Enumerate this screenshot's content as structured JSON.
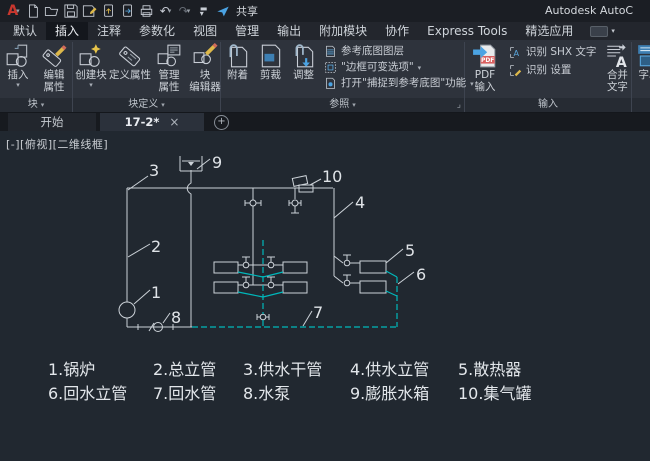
{
  "window": {
    "app_title": "Autodesk AutoC",
    "share_label": "共享"
  },
  "ribbon_tabs": [
    "默认",
    "插入",
    "注释",
    "参数化",
    "视图",
    "管理",
    "输出",
    "附加模块",
    "协作",
    "Express Tools",
    "精选应用"
  ],
  "panels": {
    "block": {
      "name": "块",
      "insert": "插入",
      "edit1": "编辑",
      "edit2": "属性"
    },
    "blockdef": {
      "name": "块定义",
      "create": "创建块",
      "defattr": "定义属性",
      "manage1": "管理",
      "manage2": "属性",
      "editor1": "块",
      "editor2": "编辑器"
    },
    "reference": {
      "name": "参照",
      "attach": "附着",
      "clip": "剪裁",
      "adjust": "调整",
      "row1": "参考底图图层",
      "row2": "\"边框可变选项\"",
      "row3": "打开\"捕捉到参考底图\"功能"
    },
    "import": {
      "name": "输入",
      "pdf1": "PDF",
      "pdf2": "输入",
      "shx": "识别 SHX 文字",
      "settings": "识别 设置",
      "combine1": "合并",
      "combine2": "文字"
    },
    "partial": {
      "field": "字段"
    }
  },
  "file_tabs": {
    "start": "开始",
    "drawing": "17-2*",
    "close": "×",
    "add": "+"
  },
  "viewport": {
    "controls": "[-][俯视][二维线框]"
  },
  "diagram": {
    "callouts": {
      "c1": "1",
      "c2": "2",
      "c3": "3",
      "c4": "4",
      "c5": "5",
      "c6": "6",
      "c7": "7",
      "c8": "8",
      "c9": "9",
      "c10": "10"
    },
    "pipe_color": "#ccd2d8",
    "return_pipe_color": "#00b7ba"
  },
  "legend": {
    "row1": [
      "1.锅炉",
      "2.总立管",
      "3.供水干管",
      "4.供水立管",
      "5.散热器"
    ],
    "row2": [
      "6.回水立管",
      "7.回水管",
      "8.水泵",
      "9.膨胀水箱",
      "10.集气罐"
    ]
  }
}
